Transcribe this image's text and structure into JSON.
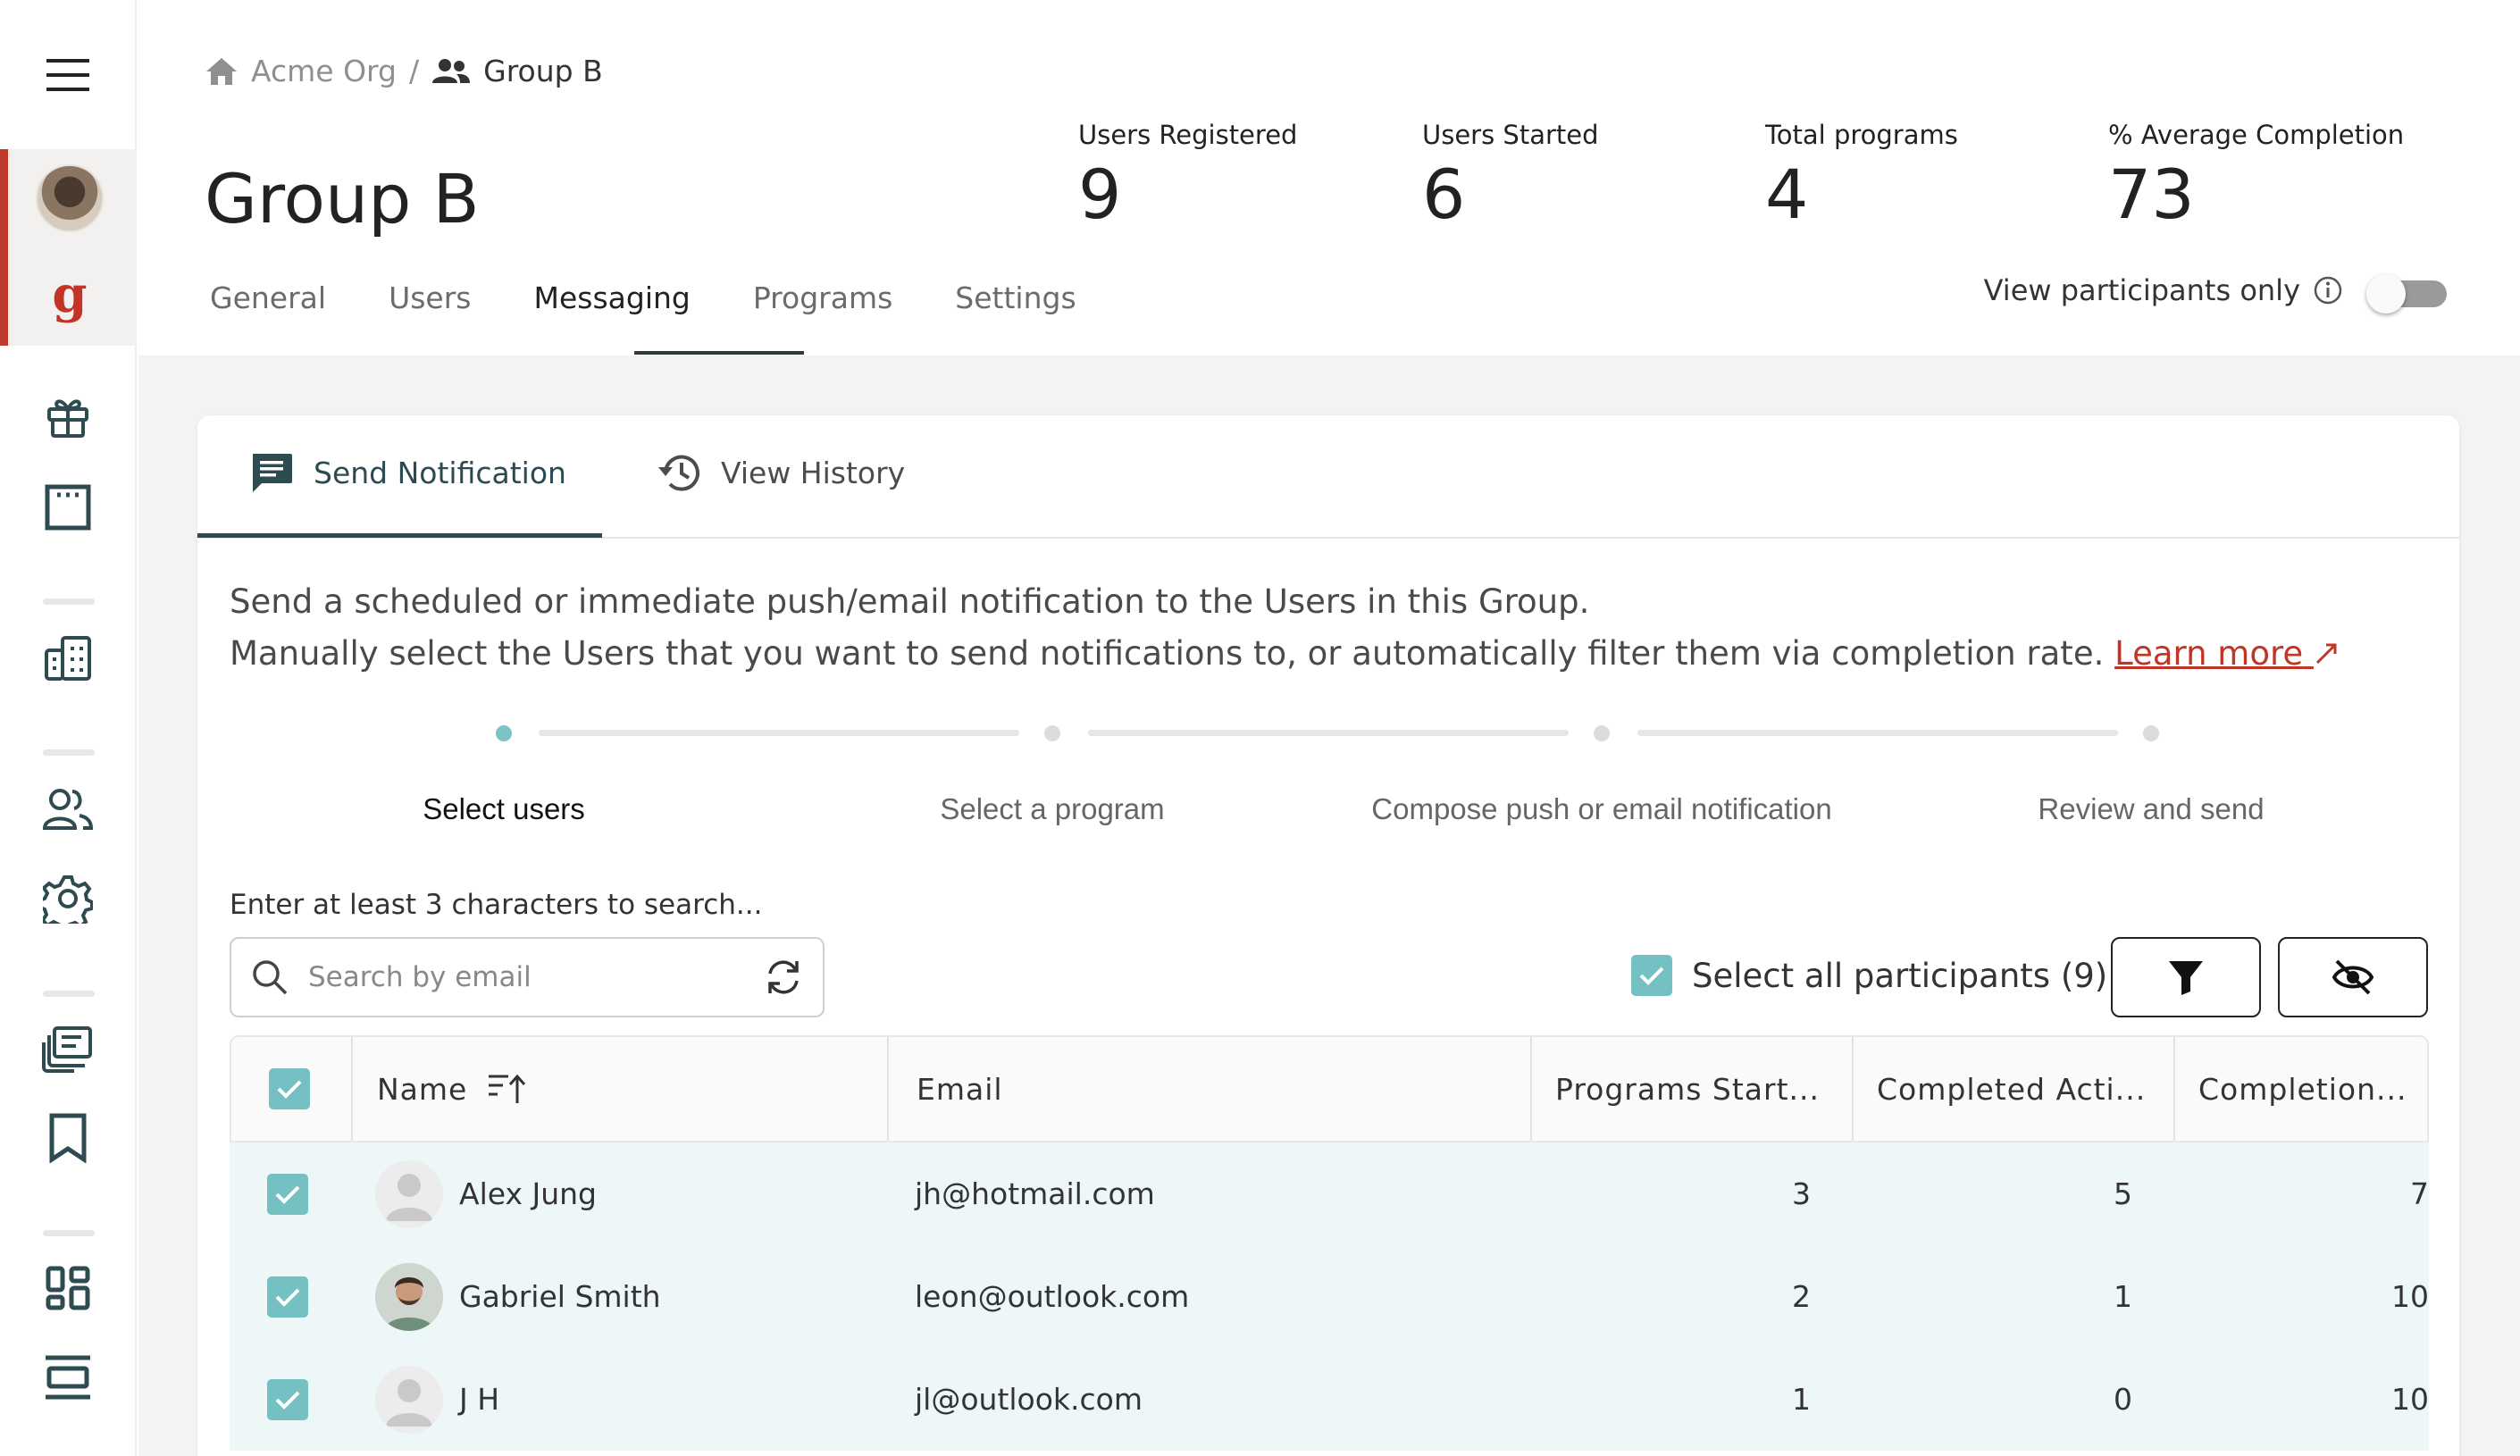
{
  "sidebar": {
    "items": [
      {
        "name": "menu-icon"
      },
      {
        "name": "gift-icon"
      },
      {
        "name": "calendar-icon"
      },
      {
        "name": "buildings-icon"
      },
      {
        "name": "users-icon"
      },
      {
        "name": "settings-icon"
      },
      {
        "name": "library-icon"
      },
      {
        "name": "bookmark-icon"
      },
      {
        "name": "dashboard-icon"
      },
      {
        "name": "layout-icon"
      }
    ],
    "org_logo_letter": "g"
  },
  "breadcrumb": {
    "root": "Acme Org",
    "separator": "/",
    "current": "Group B"
  },
  "page": {
    "title": "Group B"
  },
  "stats": [
    {
      "label": "Users Registered",
      "value": "9"
    },
    {
      "label": "Users Started",
      "value": "6"
    },
    {
      "label": "Total programs",
      "value": "4"
    },
    {
      "label": "% Average Completion",
      "value": "73"
    }
  ],
  "tabs": [
    {
      "label": "General"
    },
    {
      "label": "Users"
    },
    {
      "label": "Messaging"
    },
    {
      "label": "Programs"
    },
    {
      "label": "Settings"
    }
  ],
  "active_tab": "Messaging",
  "toggle": {
    "label": "View participants only",
    "on": false
  },
  "card": {
    "tabs": [
      {
        "label": "Send Notification"
      },
      {
        "label": "View History"
      }
    ],
    "description_line1": "Send a scheduled or immediate push/email notification to the Users in this Group.",
    "description_line2": "Manually select the Users that you want to send notifications to, or automatically filter them via completion rate.",
    "learn_more": "Learn more",
    "steps": [
      {
        "label": "Select users"
      },
      {
        "label": "Select a program"
      },
      {
        "label": "Compose push or email notification"
      },
      {
        "label": "Review and send"
      }
    ],
    "search_hint": "Enter at least 3 characters to search...",
    "search_placeholder": "Search by email",
    "select_all_label": "Select all participants (9)"
  },
  "table": {
    "columns": [
      {
        "label": "Name"
      },
      {
        "label": "Email"
      },
      {
        "label": "Programs Start..."
      },
      {
        "label": "Completed Acti..."
      },
      {
        "label": "Completion..."
      }
    ],
    "rows": [
      {
        "name": "Alex Jung",
        "email": "jh@hotmail.com",
        "programs_started": "3",
        "completed": "5",
        "completion": "7"
      },
      {
        "name": "Gabriel Smith",
        "email": "leon@outlook.com",
        "programs_started": "2",
        "completed": "1",
        "completion": "10"
      },
      {
        "name": "J H",
        "email": "jl@outlook.com",
        "programs_started": "1",
        "completed": "0",
        "completion": "10"
      }
    ]
  },
  "colors": {
    "accent_red": "#e5442f",
    "teal_check": "#74c0c2",
    "link_red": "#c23526",
    "active_tab_teal": "#2e4b52"
  }
}
